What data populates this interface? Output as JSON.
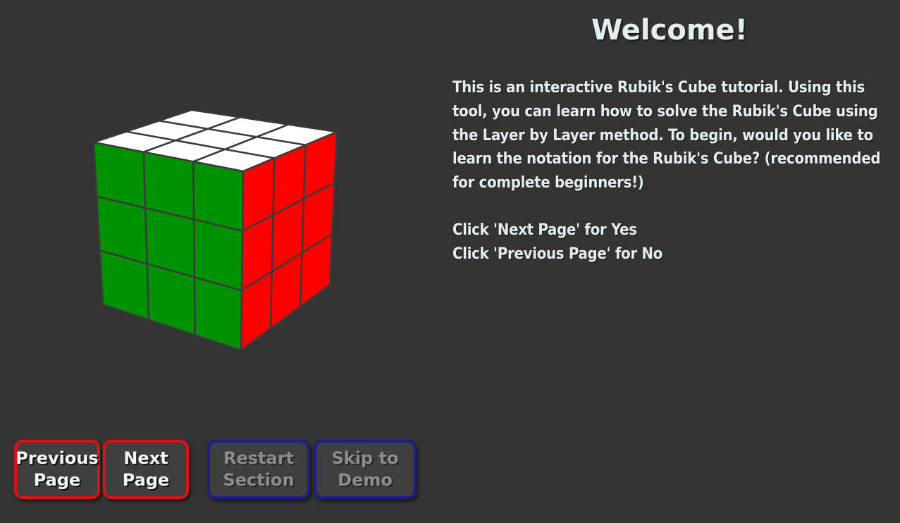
{
  "tutorial": {
    "title": "Welcome!",
    "paragraph": "This is an interactive Rubik's Cube tutorial. Using this tool, you can learn how to solve the Rubik's Cube using the Layer by Layer method. To begin, would you like to learn the notation for the Rubik's Cube? (recommended for complete beginners!)",
    "yes_line": "Click 'Next Page' for Yes",
    "no_line": "Click 'Previous Page' for No"
  },
  "buttons": {
    "previous": {
      "label": "Previous\nPage",
      "state": "enabled"
    },
    "next": {
      "label": "Next\nPage",
      "state": "enabled"
    },
    "restart": {
      "label": "Restart\nSection",
      "state": "disabled"
    },
    "skip": {
      "label": "Skip to\nDemo",
      "state": "disabled"
    }
  },
  "cube": {
    "faces": {
      "top": [
        "white",
        "white",
        "white",
        "white",
        "white",
        "white",
        "white",
        "white",
        "white"
      ],
      "front": [
        "green",
        "green",
        "green",
        "green",
        "green",
        "green",
        "green",
        "green",
        "green"
      ],
      "right": [
        "red",
        "red",
        "red",
        "red",
        "red",
        "red",
        "red",
        "red",
        "red"
      ]
    },
    "colors": {
      "white": "#ffffff",
      "green": "#009200",
      "red": "#ff0000",
      "edge": "#3a3a3a"
    }
  },
  "colors": {
    "background": "#333333",
    "text": "#e3eef3",
    "button_active_border": "#d81414",
    "button_disabled_border": "#1e1f86"
  }
}
